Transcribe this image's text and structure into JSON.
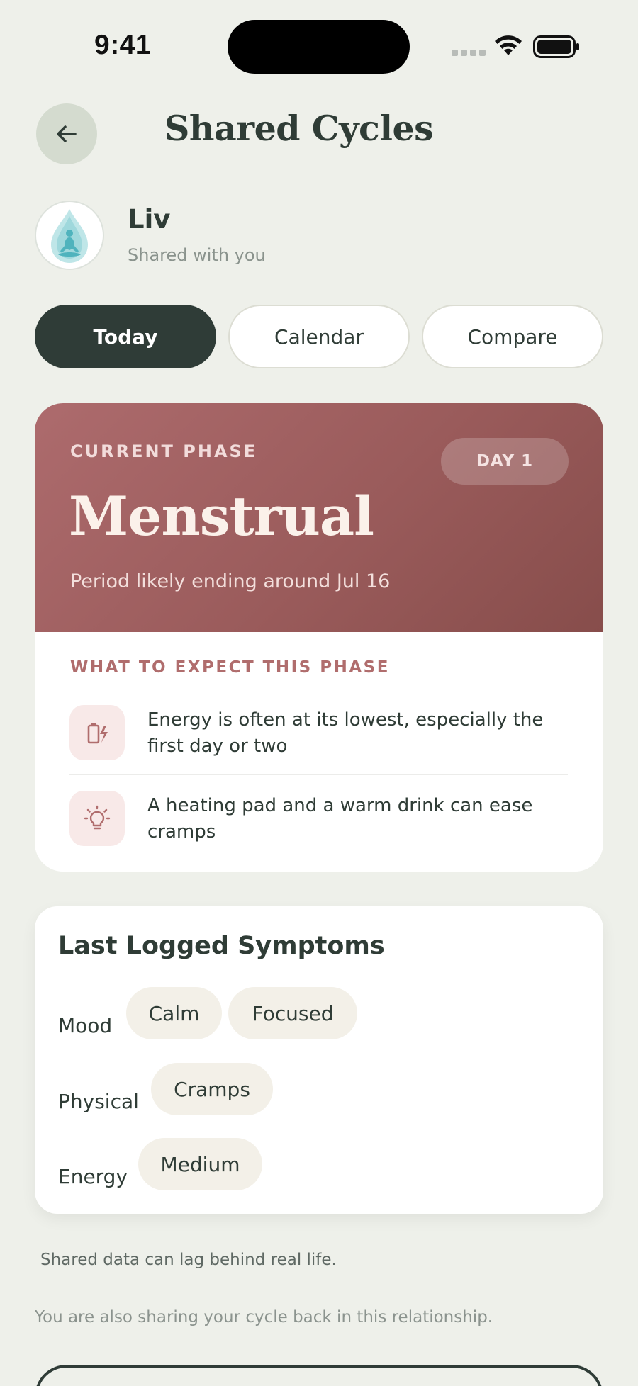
{
  "status_bar": {
    "time": "9:41"
  },
  "header": {
    "title": "Shared Cycles"
  },
  "profile": {
    "name": "Liv",
    "subtitle": "Shared with you"
  },
  "tabs": [
    {
      "label": "Today",
      "active": true
    },
    {
      "label": "Calendar",
      "active": false
    },
    {
      "label": "Compare",
      "active": false
    }
  ],
  "phase": {
    "label": "CURRENT PHASE",
    "day_badge": "DAY 1",
    "name": "Menstrual",
    "description": "Period likely ending around Jul 16",
    "expect_title": "WHAT TO EXPECT THIS PHASE",
    "tips": [
      {
        "icon": "battery-bolt-icon",
        "text": "Energy is often at its lowest, especially the first day or two"
      },
      {
        "icon": "lightbulb-icon",
        "text": "A heating pad and a warm drink can ease cramps"
      }
    ],
    "colors": {
      "hero_start": "#ad6b6d",
      "hero_end": "#874d4b",
      "accent": "#b06d6d"
    }
  },
  "symptoms": {
    "title": "Last Logged Symptoms",
    "rows": [
      {
        "label": "Mood",
        "chips": [
          "Calm",
          "Focused"
        ]
      },
      {
        "label": "Physical",
        "chips": [
          "Cramps"
        ]
      },
      {
        "label": "Energy",
        "chips": [
          "Medium"
        ]
      }
    ]
  },
  "footer": {
    "note": "Shared data can lag behind real life.",
    "sharing_note": "You are also sharing your cycle back in this relationship."
  }
}
